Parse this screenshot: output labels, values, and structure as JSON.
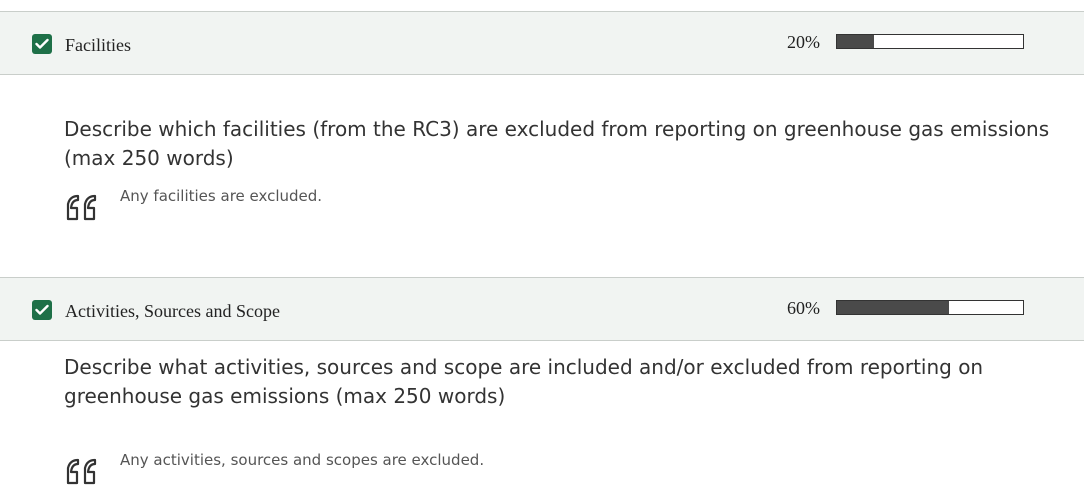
{
  "sections": [
    {
      "title": "Facilities",
      "checked": true,
      "percent_label": "20%",
      "progress": 0.2,
      "question": "Describe which facilities (from the RC3) are excluded from reporting on greenhouse gas emissions (max 250 words)",
      "answer": "Any facilities are excluded."
    },
    {
      "title": "Activities, Sources and Scope",
      "checked": true,
      "percent_label": "60%",
      "progress": 0.6,
      "question": "Describe what activities, sources and scope are included and/or excluded from reporting on greenhouse gas emissions (max 250 words)",
      "answer": "Any activities, sources and scopes are excluded."
    }
  ],
  "icons": {
    "checkbox": "check-icon",
    "quote": "quote-icon"
  },
  "colors": {
    "accent": "#1e7048",
    "header_bg": "#f1f4f2",
    "progress_fill": "#4a4a4a"
  }
}
